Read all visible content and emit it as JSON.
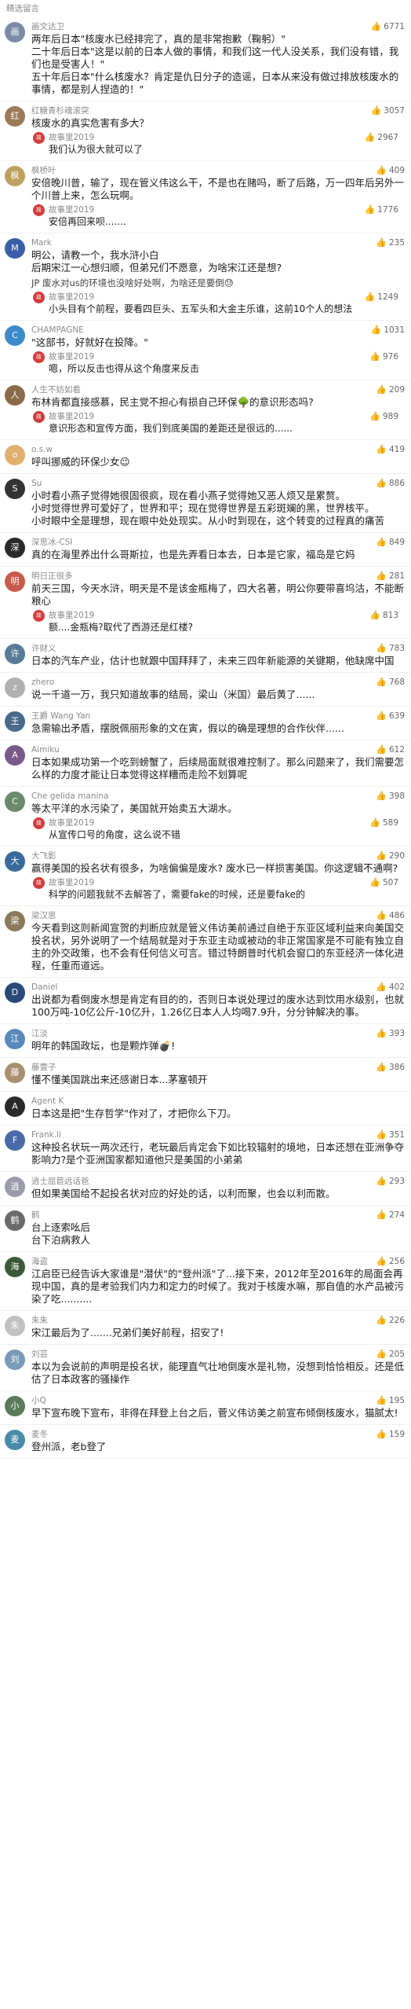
{
  "header": {
    "title": "精选留言"
  },
  "comments": [
    {
      "name": "画文达卫",
      "avatar_color": "#7c8aa5",
      "likes": "6771",
      "text": "两年后日本\"核废水已经排完了，真的是非常抱歉（鞠躬）\"\n二十年后日本\"这是以前的日本人做的事情，和我们这一代人没关系，我们没有错，我们也是受害人！\"\n五十年后日本\"什么核废水？肯定是仇日分子的造谣，日本从来没有做过排放核废水的事情，都是别人捏造的！\""
    },
    {
      "name": "红糖青杉魂滚突",
      "avatar_color": "#9c7a58",
      "likes": "3057",
      "text": "核废水的真实危害有多大？",
      "reply": {
        "name": "故事里2019",
        "text": "我们认为很大就可以了",
        "likes": "2967"
      }
    },
    {
      "name": "枫桥叶",
      "avatar_color": "#c0a060",
      "likes": "409",
      "text": "安倍晚川普，输了，现在管义伟这么干，不是也在赌吗，断了后路，万一四年后另外一个川普上来，怎么玩啊。",
      "reply": {
        "name": "故事里2019",
        "text": "安倍再回来呗.......",
        "likes": "1776"
      }
    },
    {
      "name": "Mark",
      "avatar_color": "#3a5fa8",
      "likes": "235",
      "text": "明公，请教一个，我水浒小白\n后期宋江一心想归顺，但弟兄们不愿意，为啥宋江还是想?",
      "note": "JP 废水对us的环境也没啥好处啊，为啥还是要倒😓",
      "reply": {
        "name": "故事里2019",
        "text": "小头目有个前程，要看四巨头、五军头和大金主乐谁，这前10个人的想法",
        "likes": "1249"
      }
    },
    {
      "name": "CHAMPAGNE",
      "avatar_color": "#3d8acb",
      "likes": "1031",
      "text": "\"这部书，好就好在投降。\"",
      "reply": {
        "name": "故事里2019",
        "text": "嗯，所以反击也得从这个角度来反击",
        "likes": "976"
      }
    },
    {
      "name": "人生不妨如看",
      "avatar_color": "#8b6a4a",
      "likes": "209",
      "text": "布林肯都直接感慕，民主党不担心有损自己环保🌳的意识形态吗?",
      "reply": {
        "name": "故事里2019",
        "text": "意识形态和宣传方面，我们到底美国的差距还是很远的......",
        "likes": "989"
      }
    },
    {
      "name": "o.s.w",
      "avatar_color": "#e0b070",
      "likes": "419",
      "text": "呼叫挪威的环保少女😉"
    },
    {
      "name": "Su",
      "avatar_color": "#333333",
      "likes": "886",
      "text": "小时看小燕子觉得她很固很疯，现在看小燕子觉得她又恶人烦又是累赘。\n小时觉得世界可爱好了，世界和平；现在觉得世界是五彩斑斓的黑，世界核平。\n小时眼中全是理想，现在眼中处处现实。从小时到现在，这个转变的过程真的痛苦"
    },
    {
      "name": "深思冰-CSI",
      "avatar_color": "#2a2a2a",
      "likes": "849",
      "text": "真的在海里养出什么哥斯拉，也是先弄看日本去，日本是它家，福岛是它妈"
    },
    {
      "name": "明日正很多",
      "avatar_color": "#c85a4a",
      "likes": "281",
      "text": "前天三国，今天水浒，明天是不是该金瓶梅了，四大名著，明公你要带喜坞沽，不能断粮心",
      "reply": {
        "name": "故事里2019",
        "text": "额....金瓶梅?取代了西游还是红楼?",
        "likes": "813"
      }
    },
    {
      "name": "许财义",
      "avatar_color": "#5a7a9a",
      "likes": "783",
      "text": "日本的汽车产业，估计也就跟中国拜拜了，未来三四年新能源的关键期，他缺席中国"
    },
    {
      "name": "zhero",
      "avatar_color": "#b0b0b0",
      "likes": "768",
      "text": "说一千道一万，我只知道故事的结局，梁山（米国）最后黄了......"
    },
    {
      "name": "王爵 Wang Yan",
      "avatar_color": "#4a6a8a",
      "likes": "639",
      "text": "急需输出矛盾，摆脱佩丽形象的文在寅，假以的确是理想的合作伙伴......"
    },
    {
      "name": "Aimiku",
      "avatar_color": "#7a5a8a",
      "likes": "612",
      "text": "日本如果成功第一个吃到螃蟹了，后续局面就很难控制了。那么问题来了，我们需要怎么样的力度才能让日本觉得这样糟而走险不划算呢"
    },
    {
      "name": "Che gelida manina",
      "avatar_color": "#6a8a6a",
      "likes": "398",
      "text": "等太平洋的水污染了，美国就开始卖五大湖水。",
      "reply": {
        "name": "故事里2019",
        "text": "从宣传口号的角度，这么说不错",
        "likes": "589"
      }
    },
    {
      "name": "大飞影",
      "avatar_color": "#3a6a9a",
      "likes": "290",
      "text": "赢得美国的投名状有很多，为啥偏偏是废水? 废水已一样损害美国。你这逻辑不通啊?",
      "reply": {
        "name": "故事里2019",
        "text": "科学的问题我就不去解答了，需要fake的时候，还是要fake的",
        "likes": "507"
      }
    },
    {
      "name": "梁汉思",
      "avatar_color": "#8a7a5a",
      "likes": "486",
      "text": "今天看到这则新闻宣贺的判断应就是管义伟访美前通过自绝于东亚区域利益来向美国交投名状，另外说明了一个结局就是对于东亚主动或被动的非正常国家是不可能有独立自主的外交政策，也不会有任何信义可言。错过特朗普时代机会窗口的东亚经济一体化进程，任重而道远。"
    },
    {
      "name": "Daniel",
      "avatar_color": "#2a4a7a",
      "likes": "402",
      "text": "出说都为看倒废水想是肯定有目的的，否则日本说处理过的废水达到饮用水级别，也就100万吨-10亿公斤-10亿升，1.26亿日本人人均喝7.9升，分分钟解决的事。"
    },
    {
      "name": "江淡",
      "avatar_color": "#5a8aba",
      "likes": "393",
      "text": "明年的韩国政坛，也是颗炸弹💣!"
    },
    {
      "name": "藤壹子",
      "avatar_color": "#a89070",
      "likes": "386",
      "text": "懂不懂美国跳出来还感谢日本...茅塞顿开"
    },
    {
      "name": "Agent K",
      "avatar_color": "#2a2a2a",
      "likes": "",
      "text": "日本这是把\"生存哲学\"作对了，才把你么下刀。"
    },
    {
      "name": "Frank.li",
      "avatar_color": "#4a6aaa",
      "likes": "351",
      "text": "这种投名状玩一两次还行，老玩最后肯定会下如比较辐射的境地，日本还想在亚洲争夺影响力?是个亚洲国家都知道他只是美国的小弟弟"
    },
    {
      "name": "逍士屈苣远话爸",
      "avatar_color": "#9a9aaa",
      "likes": "293",
      "text": "但如果美国给不起投名状对应的好处的话，以利而聚，也会以利而散。"
    },
    {
      "name": "鹤",
      "avatar_color": "#6a6a6a",
      "likes": "274",
      "text": "台上逐索吆后\n台下泊病救人"
    },
    {
      "name": "海盗",
      "avatar_color": "#3a5a3a",
      "likes": "256",
      "text": "江启臣已经告诉大家谁是\"潜伏\"的\"登州派\"了...接下来，2012年至2016年的局面会再现中国，真的是考验我们内力和定力的时候了。我对于核废水嘛，那自值的水产品被污染了吃.........."
    },
    {
      "name": "朱朱",
      "avatar_color": "#c0c0c0",
      "likes": "226",
      "text": "宋江最后为了.......兄弟们美好前程，招安了!"
    },
    {
      "name": "刘芸",
      "avatar_color": "#7a9aba",
      "likes": "205",
      "text": "本以为会说前的声明是投名状，能理直气壮地倒废水是礼物，没想到恰恰相反。还是低估了日本政客的骚操作"
    },
    {
      "name": "小Q",
      "avatar_color": "#5a7a5a",
      "likes": "195",
      "text": "早下宣布晚下宣布，非得在拜登上台之后，菅义伟访美之前宣布倾倒核废水，猫腻太!"
    },
    {
      "name": "麦冬",
      "avatar_color": "#4a8aaa",
      "likes": "159",
      "text": "登州派，老b登了"
    }
  ]
}
